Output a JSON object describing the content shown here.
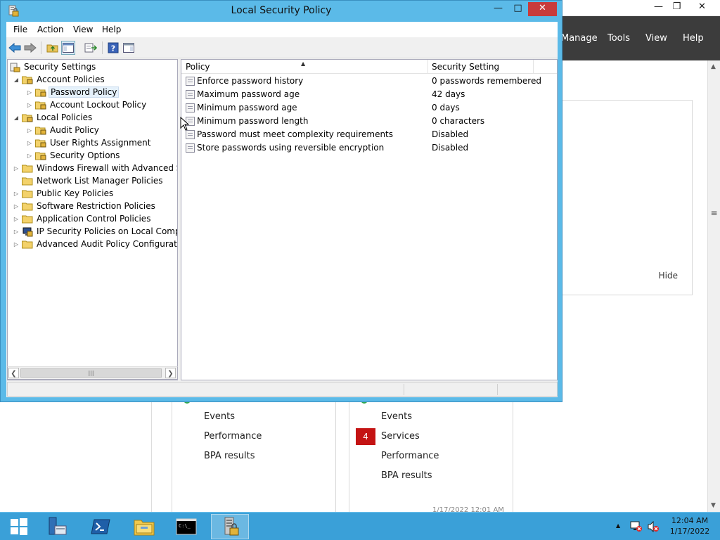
{
  "server_manager": {
    "menu": [
      "Manage",
      "Tools",
      "View",
      "Help"
    ],
    "hide_label": "Hide",
    "tile1": {
      "items": [
        "Events",
        "Performance",
        "BPA results"
      ]
    },
    "tile2": {
      "badge": "4",
      "items": [
        "Events",
        "Services",
        "Performance",
        "BPA results"
      ],
      "date": "1/17/2022 12:01 AM"
    }
  },
  "window": {
    "title": "Local Security Policy",
    "menu": [
      "File",
      "Action",
      "View",
      "Help"
    ],
    "tree": [
      {
        "label": "Security Settings"
      },
      {
        "label": "Account Policies"
      },
      {
        "label": "Password Policy"
      },
      {
        "label": "Account Lockout Policy"
      },
      {
        "label": "Local Policies"
      },
      {
        "label": "Audit Policy"
      },
      {
        "label": "User Rights Assignment"
      },
      {
        "label": "Security Options"
      },
      {
        "label": "Windows Firewall with Advanced Security"
      },
      {
        "label": "Network List Manager Policies"
      },
      {
        "label": "Public Key Policies"
      },
      {
        "label": "Software Restriction Policies"
      },
      {
        "label": "Application Control Policies"
      },
      {
        "label": "IP Security Policies on Local Computer"
      },
      {
        "label": "Advanced Audit Policy Configuration"
      }
    ],
    "list": {
      "columns": [
        "Policy",
        "Security Setting"
      ],
      "rows": [
        {
          "policy": "Enforce password history",
          "setting": "0 passwords remembered"
        },
        {
          "policy": "Maximum password age",
          "setting": "42 days"
        },
        {
          "policy": "Minimum password age",
          "setting": "0 days"
        },
        {
          "policy": "Minimum password length",
          "setting": "0 characters"
        },
        {
          "policy": "Password must meet complexity requirements",
          "setting": "Disabled"
        },
        {
          "policy": "Store passwords using reversible encryption",
          "setting": "Disabled"
        }
      ]
    }
  },
  "taskbar": {
    "time": "12:04 AM",
    "date": "1/17/2022"
  },
  "colors": {
    "window_frame": "#5bbae8",
    "taskbar": "#3aa0d8",
    "close_button": "#c83b3b",
    "sm_header": "#3c3c3c",
    "badge": "#c41313"
  }
}
